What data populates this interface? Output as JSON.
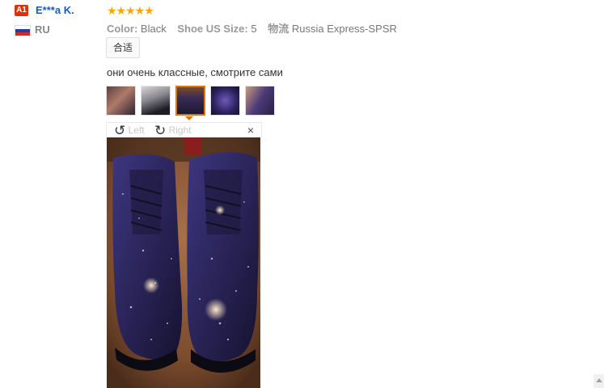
{
  "reviewer": {
    "badge": "A1",
    "name": "E***a K.",
    "country": "RU"
  },
  "rating": {
    "stars": "★★★★★",
    "value": 5
  },
  "meta": {
    "color_label": "Color:",
    "color_value": "Black",
    "size_label": "Shoe US Size:",
    "size_value": "5",
    "ship_label": "物流",
    "ship_value": "Russia Express-SPSR"
  },
  "fit_tag": "合适",
  "review_text": "они очень классные, смотрите сами",
  "viewer": {
    "rotate_left": "Left",
    "rotate_right": "Right",
    "close": "×",
    "rotate_left_icon": "↺",
    "rotate_right_icon": "↻"
  },
  "colors": {
    "accent": "#d77612",
    "link": "#1a5bb8",
    "star": "#ffa500",
    "badge": "#e62e04"
  }
}
